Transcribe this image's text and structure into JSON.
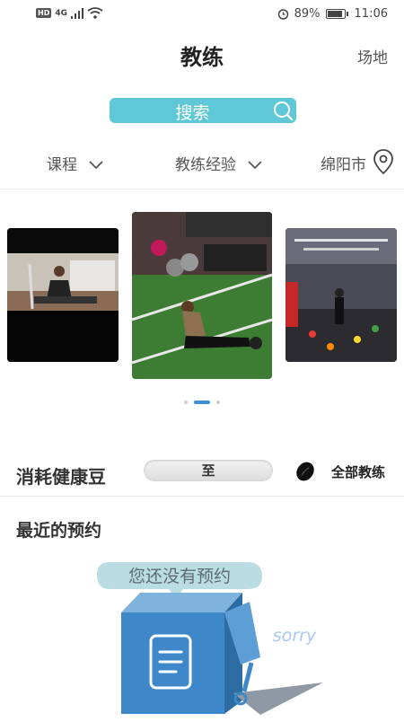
{
  "status": {
    "hd": "HD",
    "network": "4G",
    "battery": "89%",
    "time": "11:06"
  },
  "header": {
    "title": "教练",
    "right_link": "场地"
  },
  "search": {
    "placeholder": "搜索"
  },
  "filters": {
    "course": "课程",
    "experience": "教练经验",
    "city": "绵阳市"
  },
  "carousel": {
    "active_index": 1,
    "count": 3
  },
  "beans": {
    "label": "消耗健康豆",
    "range_separator": "至",
    "all_coaches": "全部教练"
  },
  "recent": {
    "title": "最近的预约",
    "empty_message": "您还没有预约",
    "empty_caption": "sorry"
  },
  "colors": {
    "accent": "#5ec7d8",
    "active_dot": "#3a8fd6"
  }
}
